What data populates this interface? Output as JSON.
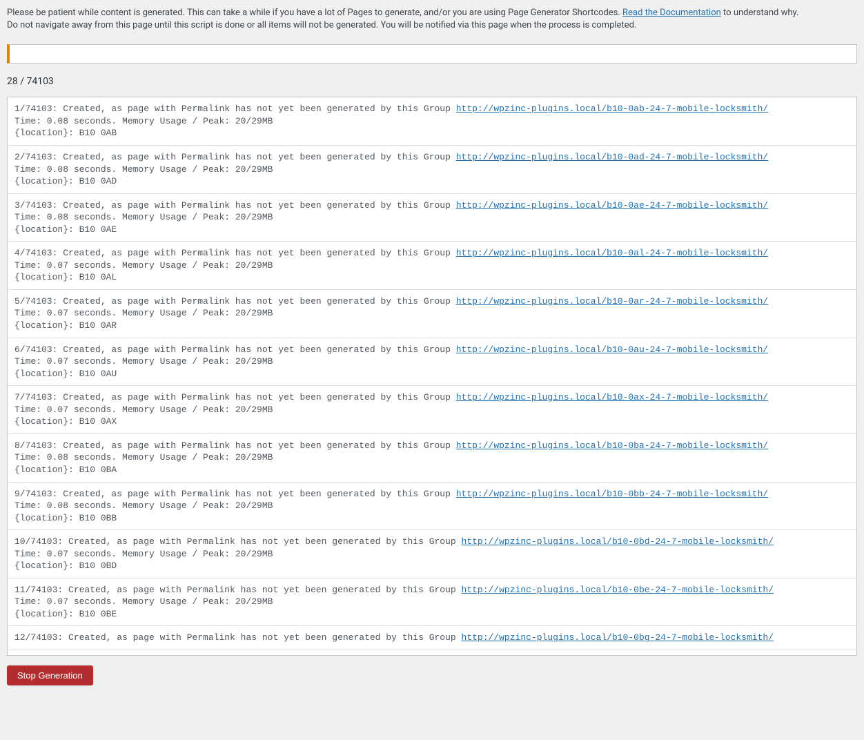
{
  "intro": {
    "line1_pre": "Please be patient while content is generated. This can take a while if you have a lot of Pages to generate, and/or you are using Page Generator Shortcodes. ",
    "link_text": "Read the Documentation",
    "line1_post": " to understand why.",
    "line2": "Do not navigate away from this page until this script is done or all items will not be generated. You will be notified via this page when the process is completed."
  },
  "counter": "28 / 74103",
  "button": {
    "stop": "Stop Generation"
  },
  "logs": [
    {
      "prefix": "1/74103: Created, as page with Permalink has not yet been generated by this Group ",
      "url": "http://wpzinc-plugins.local/b10-0ab-24-7-mobile-locksmith/",
      "time": "Time: 0.08 seconds. Memory Usage / Peak: 20/29MB",
      "loc": "{location}: B10 0AB"
    },
    {
      "prefix": "2/74103: Created, as page with Permalink has not yet been generated by this Group ",
      "url": "http://wpzinc-plugins.local/b10-0ad-24-7-mobile-locksmith/",
      "time": "Time: 0.08 seconds. Memory Usage / Peak: 20/29MB",
      "loc": "{location}: B10 0AD"
    },
    {
      "prefix": "3/74103: Created, as page with Permalink has not yet been generated by this Group ",
      "url": "http://wpzinc-plugins.local/b10-0ae-24-7-mobile-locksmith/",
      "time": "Time: 0.08 seconds. Memory Usage / Peak: 20/29MB",
      "loc": "{location}: B10 0AE"
    },
    {
      "prefix": "4/74103: Created, as page with Permalink has not yet been generated by this Group ",
      "url": "http://wpzinc-plugins.local/b10-0al-24-7-mobile-locksmith/",
      "time": "Time: 0.07 seconds. Memory Usage / Peak: 20/29MB",
      "loc": "{location}: B10 0AL"
    },
    {
      "prefix": "5/74103: Created, as page with Permalink has not yet been generated by this Group ",
      "url": "http://wpzinc-plugins.local/b10-0ar-24-7-mobile-locksmith/",
      "time": "Time: 0.07 seconds. Memory Usage / Peak: 20/29MB",
      "loc": "{location}: B10 0AR"
    },
    {
      "prefix": "6/74103: Created, as page with Permalink has not yet been generated by this Group ",
      "url": "http://wpzinc-plugins.local/b10-0au-24-7-mobile-locksmith/",
      "time": "Time: 0.07 seconds. Memory Usage / Peak: 20/29MB",
      "loc": "{location}: B10 0AU"
    },
    {
      "prefix": "7/74103: Created, as page with Permalink has not yet been generated by this Group ",
      "url": "http://wpzinc-plugins.local/b10-0ax-24-7-mobile-locksmith/",
      "time": "Time: 0.07 seconds. Memory Usage / Peak: 20/29MB",
      "loc": "{location}: B10 0AX"
    },
    {
      "prefix": "8/74103: Created, as page with Permalink has not yet been generated by this Group ",
      "url": "http://wpzinc-plugins.local/b10-0ba-24-7-mobile-locksmith/",
      "time": "Time: 0.08 seconds. Memory Usage / Peak: 20/29MB",
      "loc": "{location}: B10 0BA"
    },
    {
      "prefix": "9/74103: Created, as page with Permalink has not yet been generated by this Group ",
      "url": "http://wpzinc-plugins.local/b10-0bb-24-7-mobile-locksmith/",
      "time": "Time: 0.08 seconds. Memory Usage / Peak: 20/29MB",
      "loc": "{location}: B10 0BB"
    },
    {
      "prefix": "10/74103: Created, as page with Permalink has not yet been generated by this Group ",
      "url": "http://wpzinc-plugins.local/b10-0bd-24-7-mobile-locksmith/",
      "time": "Time: 0.07 seconds. Memory Usage / Peak: 20/29MB",
      "loc": "{location}: B10 0BD"
    },
    {
      "prefix": "11/74103: Created, as page with Permalink has not yet been generated by this Group ",
      "url": "http://wpzinc-plugins.local/b10-0be-24-7-mobile-locksmith/",
      "time": "Time: 0.07 seconds. Memory Usage / Peak: 20/29MB",
      "loc": "{location}: B10 0BE"
    },
    {
      "prefix": "12/74103: Created, as page with Permalink has not yet been generated by this Group ",
      "url": "http://wpzinc-plugins.local/b10-0bg-24-7-mobile-locksmith/",
      "time": "",
      "loc": ""
    }
  ]
}
